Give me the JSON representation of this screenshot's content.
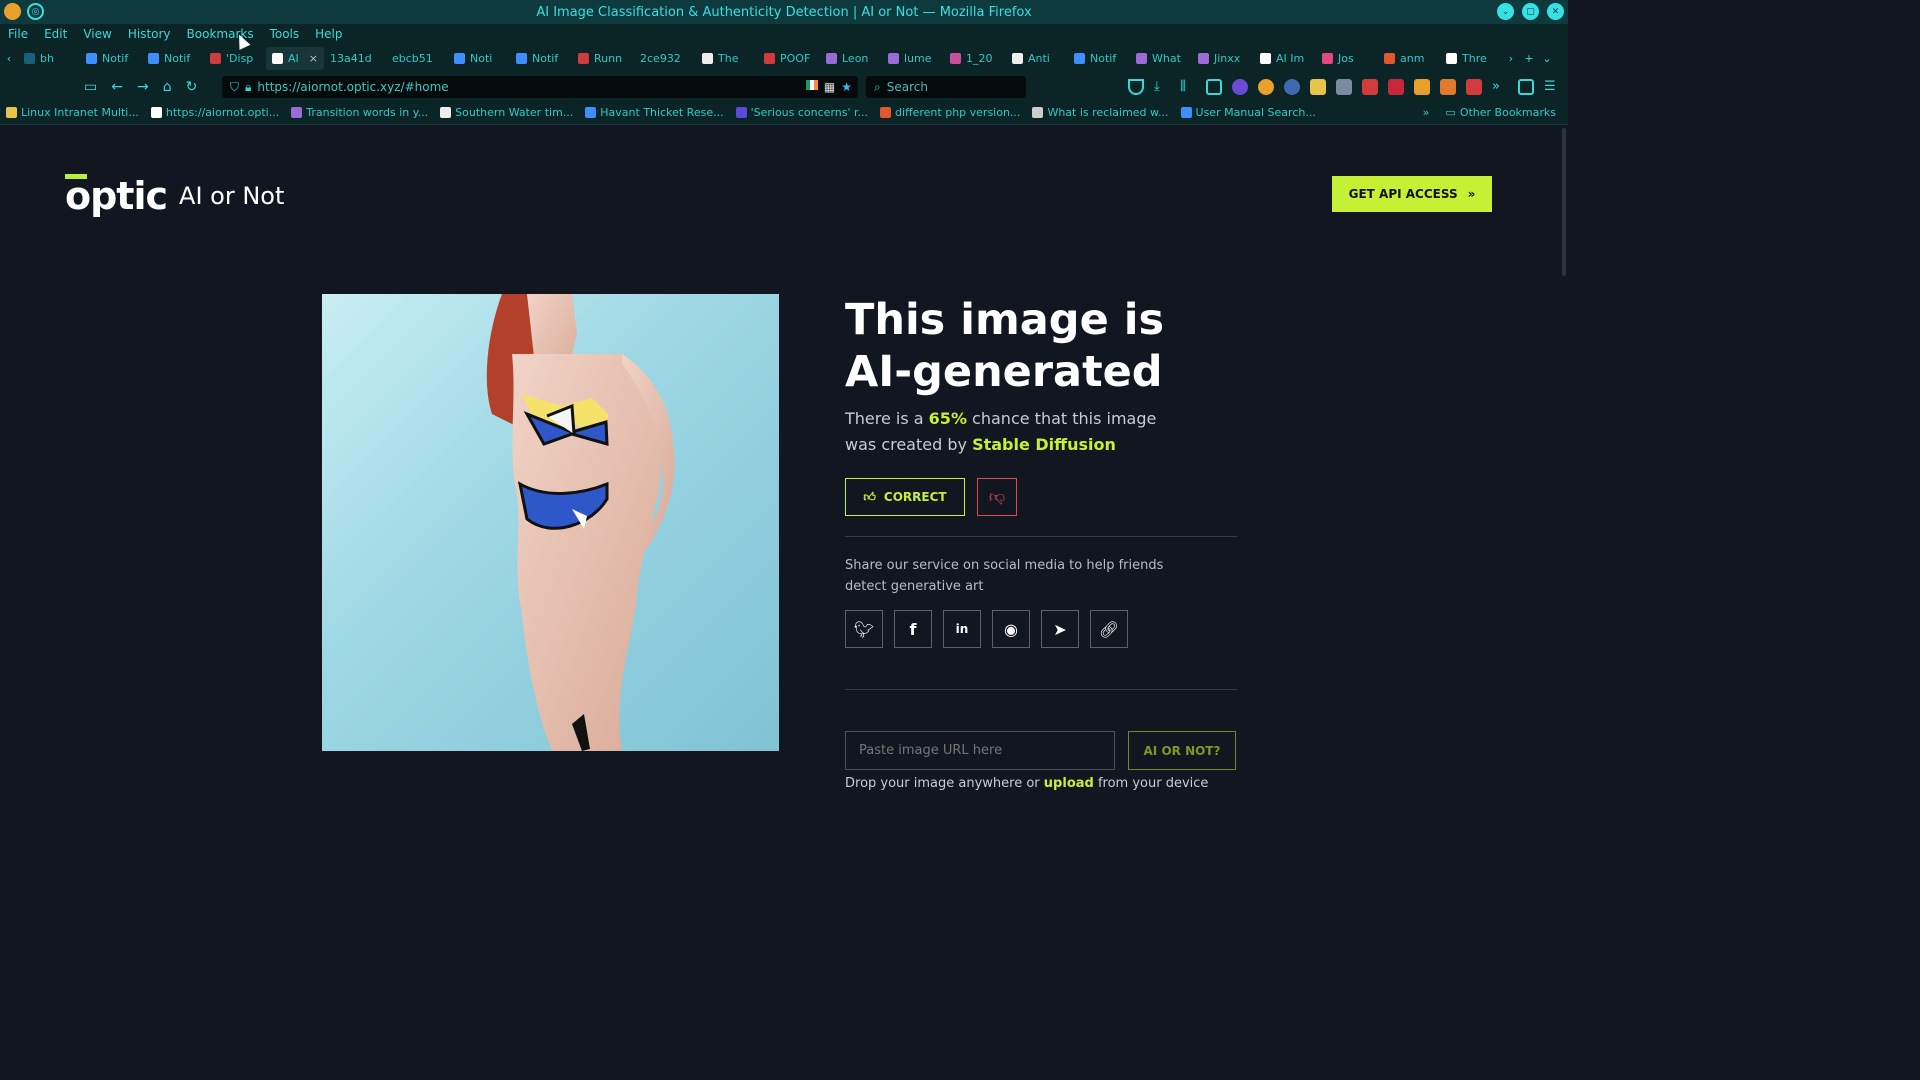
{
  "window": {
    "title": "AI Image Classification & Authenticity Detection | AI or Not — Mozilla Firefox"
  },
  "menu": [
    "File",
    "Edit",
    "View",
    "History",
    "Bookmarks",
    "Tools",
    "Help"
  ],
  "tabs": [
    {
      "label": "bh",
      "color": "#1a5f7a"
    },
    {
      "label": "Notif",
      "color": "#3d8eff"
    },
    {
      "label": "Notif",
      "color": "#3d8eff"
    },
    {
      "label": "'Disp",
      "color": "#d23b3b"
    },
    {
      "label": "AI",
      "color": "#ffffff",
      "active": true
    },
    {
      "label": "13a41d",
      "color": ""
    },
    {
      "label": "ebcb51",
      "color": ""
    },
    {
      "label": "Noti",
      "color": "#3d8eff"
    },
    {
      "label": "Notif",
      "color": "#3d8eff"
    },
    {
      "label": "Runn",
      "color": "#d23b3b"
    },
    {
      "label": "2ce932",
      "color": ""
    },
    {
      "label": "The",
      "color": "#eeeeee"
    },
    {
      "label": "POOF",
      "color": "#d23b3b"
    },
    {
      "label": "Leon",
      "color": "#9a6bd6"
    },
    {
      "label": "lume",
      "color": "#9a6bd6"
    },
    {
      "label": "1_20",
      "color": "#c84f9c"
    },
    {
      "label": "Anti",
      "color": "#eeeeee"
    },
    {
      "label": "Notif",
      "color": "#3d8eff"
    },
    {
      "label": "What",
      "color": "#9a6bd6"
    },
    {
      "label": "Jinxx",
      "color": "#9a6bd6"
    },
    {
      "label": "AI Im",
      "color": "#ffffff"
    },
    {
      "label": "Jos",
      "color": "#e2497a"
    },
    {
      "label": "anm",
      "color": "#e0582e"
    },
    {
      "label": "Thre",
      "color": "#ffffff"
    }
  ],
  "nav": {
    "url": "https://aiornot.optic.xyz/#home",
    "search_placeholder": "Search"
  },
  "bookmarks": [
    {
      "label": "Linux Intranet Multi...",
      "color": "#e8c44a"
    },
    {
      "label": "https://aiornot.opti...",
      "color": "#ffffff"
    },
    {
      "label": "Transition words in y...",
      "color": "#9a6bd6"
    },
    {
      "label": "Southern Water tim...",
      "color": "#eeeeee"
    },
    {
      "label": "Havant Thicket Rese...",
      "color": "#3d8eff"
    },
    {
      "label": "'Serious concerns' r...",
      "color": "#5a4ad6"
    },
    {
      "label": "different php version...",
      "color": "#e0582e"
    },
    {
      "label": "What is reclaimed w...",
      "color": "#cccccc"
    },
    {
      "label": "User Manual Search...",
      "color": "#3d8eff"
    }
  ],
  "bookmarks_other": "Other Bookmarks",
  "page": {
    "brand": "optic",
    "brand_tag": "AI or Not",
    "api_button": "GET API ACCESS",
    "headline": "This image is AI-generated",
    "chance_pre": "There is a ",
    "chance_pct": "65%",
    "chance_mid": " chance that this image was created by ",
    "chance_model": "Stable Diffusion",
    "correct_label": "CORRECT",
    "share_text": "Share our service on social media to help friends detect generative art",
    "social": [
      "twitter-icon",
      "facebook-icon",
      "linkedin-icon",
      "reddit-icon",
      "telegram-icon",
      "link-icon"
    ],
    "url_placeholder": "Paste image URL here",
    "ai_button": "AI OR NOT?",
    "drop_pre": "Drop your image anywhere or ",
    "drop_link": "upload",
    "drop_post": " from your device"
  },
  "colors": {
    "accent": "#c6f033",
    "negative": "#e04949",
    "background": "#121620",
    "chrome": "#0b2426",
    "chrome_text": "#36e0e3"
  }
}
